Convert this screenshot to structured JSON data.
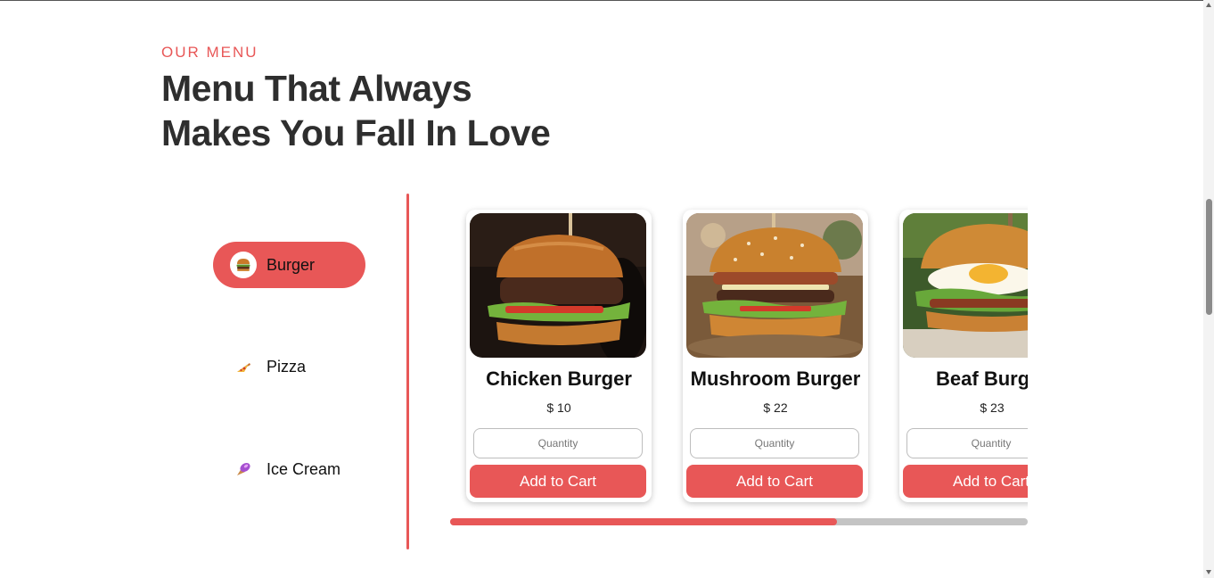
{
  "section": {
    "eyebrow": "OUR MENU",
    "headline_line1": "Menu That Always",
    "headline_line2": "Makes You Fall In Love"
  },
  "categories": [
    {
      "label": "Burger",
      "icon": "burger-icon",
      "active": true
    },
    {
      "label": "Pizza",
      "icon": "pizza-icon",
      "active": false
    },
    {
      "label": "Ice Cream",
      "icon": "ice-cream-icon",
      "active": false
    }
  ],
  "products": [
    {
      "name": "Chicken Burger",
      "price": "$ 10",
      "quantity_placeholder": "Quantity",
      "button_label": "Add to Cart"
    },
    {
      "name": "Mushroom Burger",
      "price": "$ 22",
      "quantity_placeholder": "Quantity",
      "button_label": "Add to Cart"
    },
    {
      "name": "Beaf Burger",
      "price": "$ 23",
      "quantity_placeholder": "Quantity",
      "button_label": "Add to Cart"
    }
  ],
  "carousel": {
    "scroll_progress": 0.67
  },
  "page_scrollbar": {
    "scroll_position": 0.43
  },
  "colors": {
    "accent": "#e85757",
    "heading": "#2e2e2e",
    "track": "#c4c4c4"
  }
}
